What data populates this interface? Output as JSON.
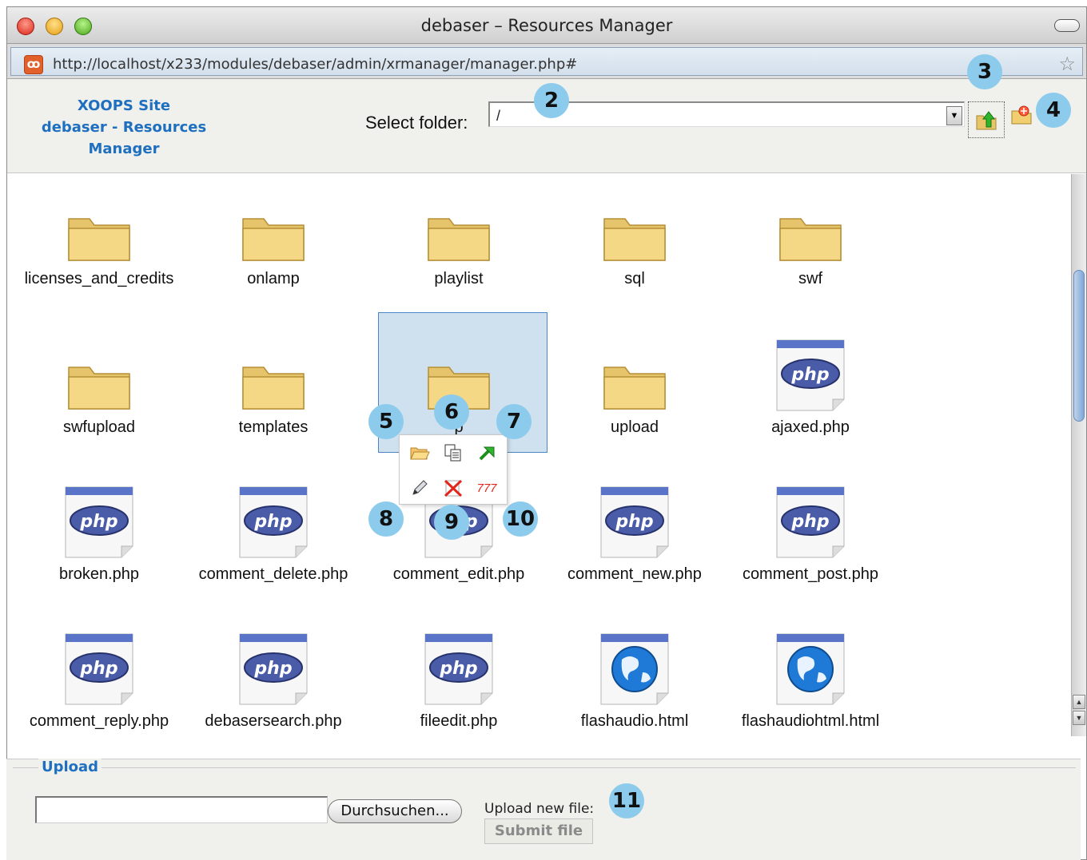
{
  "window": {
    "title": "debaser – Resources Manager"
  },
  "browser": {
    "url": "http://localhost/x233/modules/debaser/admin/xrmanager/manager.php#"
  },
  "header": {
    "site_title_line1": "XOOPS Site",
    "site_title_line2": "debaser - Resources",
    "site_title_line3": "Manager",
    "select_folder_label": "Select folder:",
    "folder_value": "/"
  },
  "items": [
    {
      "name": "licenses_and_credits",
      "type": "folder"
    },
    {
      "name": "onlamp",
      "type": "folder"
    },
    {
      "name": "playlist",
      "type": "folder"
    },
    {
      "name": "sql",
      "type": "folder"
    },
    {
      "name": "swf",
      "type": "folder"
    },
    {
      "name": "swfupload",
      "type": "folder"
    },
    {
      "name": "templates",
      "type": "folder"
    },
    {
      "name": "p",
      "type": "folder"
    },
    {
      "name": "upload",
      "type": "folder"
    },
    {
      "name": "ajaxed.php",
      "type": "php"
    },
    {
      "name": "broken.php",
      "type": "php"
    },
    {
      "name": "comment_delete.php",
      "type": "php"
    },
    {
      "name": "comment_edit.php",
      "type": "php"
    },
    {
      "name": "comment_new.php",
      "type": "php"
    },
    {
      "name": "comment_post.php",
      "type": "php"
    },
    {
      "name": "comment_reply.php",
      "type": "php"
    },
    {
      "name": "debasersearch.php",
      "type": "php"
    },
    {
      "name": "fileedit.php",
      "type": "php"
    },
    {
      "name": "flashaudio.html",
      "type": "html"
    },
    {
      "name": "flashaudiohtml.html",
      "type": "html"
    }
  ],
  "context_menu": {
    "open_icon": "open-folder-icon",
    "copy_icon": "copy-icon",
    "move_icon": "move-arrow-icon",
    "rename_icon": "pencil-icon",
    "delete_icon": "delete-icon",
    "chmod_label": "777"
  },
  "callouts": [
    "2",
    "3",
    "4",
    "5",
    "6",
    "7",
    "8",
    "9",
    "10",
    "11"
  ],
  "icon_labels": {
    "php": "php"
  },
  "upload": {
    "legend": "Upload",
    "browse_label": "Durchsuchen...",
    "new_file_label": "Upload new file:",
    "submit_label": "Submit file"
  },
  "colors": {
    "accent_blue": "#1e6fbf",
    "callout": "#8ccbec",
    "selection": "#cfe0ee"
  }
}
